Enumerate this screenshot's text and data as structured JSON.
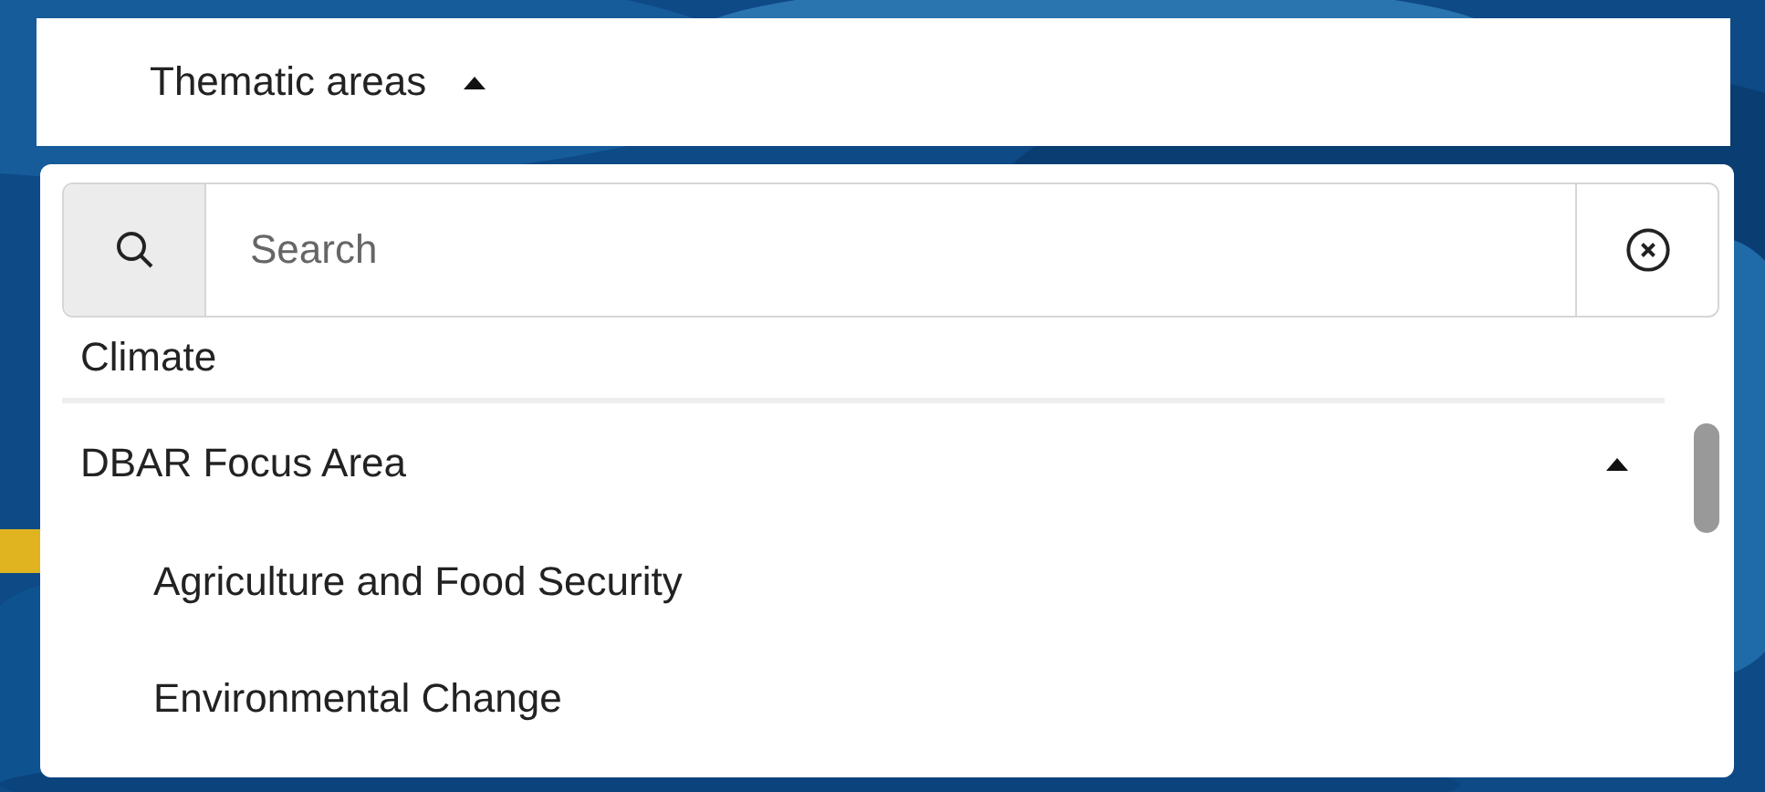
{
  "header": {
    "label": "Thematic areas",
    "expanded": true
  },
  "search": {
    "placeholder": "Search"
  },
  "items": [
    {
      "label": "Climate"
    },
    {
      "label": "DBAR Focus Area",
      "expanded": true,
      "children": [
        {
          "label": "Agriculture and Food Security"
        },
        {
          "label": "Environmental Change"
        }
      ]
    }
  ]
}
